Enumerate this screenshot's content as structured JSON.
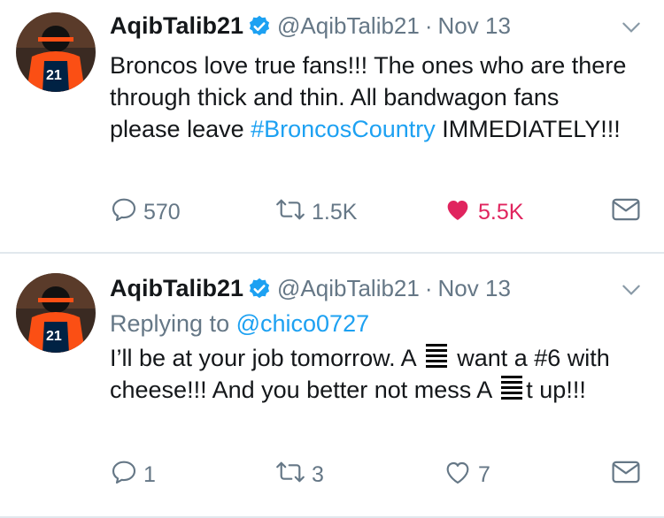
{
  "tweets": [
    {
      "name": "AqibTalib21",
      "handle": "@AqibTalib21",
      "separator": "·",
      "date": "Nov 13",
      "text_plain": "Broncos love true fans!!! The ones who are there through thick and thin. All bandwagon fans please leave ",
      "hashtag": "#BroncosCountry",
      "text_after": " IMMEDIATELY!!!",
      "replies": "570",
      "retweets": "1.5K",
      "likes": "5.5K",
      "liked": true
    },
    {
      "name": "AqibTalib21",
      "handle": "@AqibTalib21",
      "separator": "·",
      "date": "Nov 13",
      "replying_label": "Replying to ",
      "replying_to": "@chico0727",
      "text_part1": "I’ll be at your job tomorrow. A ",
      "text_part2": " want a #6 with cheese!!! And you better not mess A ",
      "text_part3": "t up!!!",
      "replies": "1",
      "retweets": "3",
      "likes": "7",
      "liked": false
    }
  ],
  "colors": {
    "accent": "#1da1f2",
    "like": "#e0245e",
    "muted": "#657786",
    "avatar_primary": "#fb4f14",
    "avatar_secondary": "#002244"
  },
  "icons": [
    "verified-badge-icon",
    "chevron-down-icon",
    "reply-icon",
    "retweet-icon",
    "heart-icon",
    "direct-message-icon"
  ]
}
